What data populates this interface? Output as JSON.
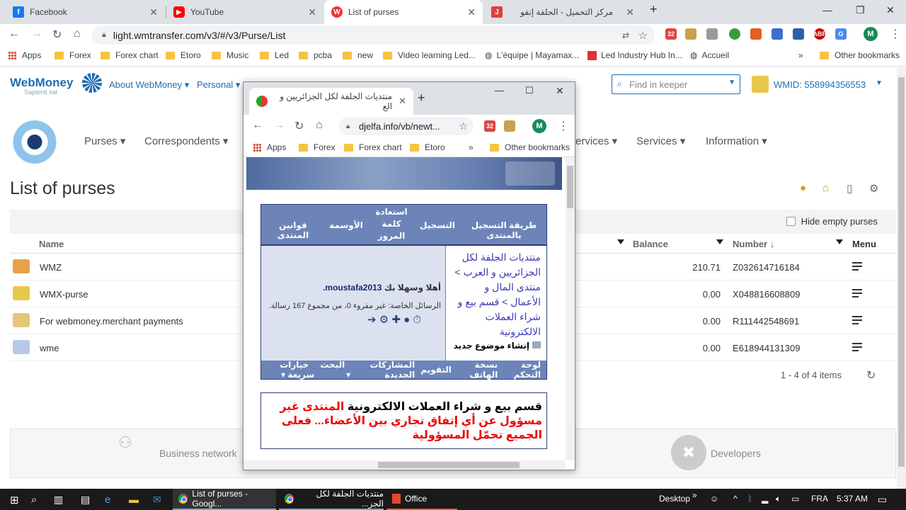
{
  "browser": {
    "tabs": [
      {
        "label": "Facebook",
        "icon": "facebook-icon"
      },
      {
        "label": "YouTube",
        "icon": "youtube-icon"
      },
      {
        "label": "List of purses",
        "icon": "webmoney-icon"
      },
      {
        "label": "مركز التحميل - الجلفة إنفو",
        "icon": "djelfa-icon"
      }
    ],
    "url": "light.wmtransfer.com/v3/#/v3/Purse/List",
    "bookmarks": [
      "Apps",
      "Forex",
      "Forex chart",
      "Etoro",
      "Music",
      "Led",
      "pcba",
      "new",
      "Video learning Led...",
      "L'équipe | Mayamax...",
      "Led Industry Hub In...",
      "Accueil",
      "Other bookmarks"
    ],
    "ext_badge": "32",
    "profile": "M"
  },
  "wm": {
    "logo": "WebMoney",
    "logo_sub": "Sapienti sat",
    "about": "About WebMoney",
    "personal": "Personal",
    "search_placeholder": "Find in keeper",
    "wmid": "WMID: 558994356553",
    "nav": [
      "Purses",
      "Correspondents",
      "ervices",
      "Services",
      "Information"
    ],
    "title": "List of purses",
    "hide_empty": "Hide empty purses",
    "columns": {
      "name": "Name",
      "balance": "Balance",
      "number": "Number ↓",
      "menu": "Menu"
    },
    "purses": [
      {
        "name": "WMZ",
        "balance": "210.71",
        "number": "Z032614716184",
        "color": "#e8a14a"
      },
      {
        "name": "WMX-purse",
        "balance": "0.00",
        "number": "X048816608809",
        "color": "#e8c84a"
      },
      {
        "name": "For webmoney.merchant payments",
        "balance": "0.00",
        "number": "R111442548691",
        "color": "#e3c67a"
      },
      {
        "name": "wme",
        "balance": "0.00",
        "number": "E618944131309",
        "color": "#b8c8e8"
      }
    ],
    "pager": "1 - 4 of 4 items",
    "footer": {
      "business": "Business network",
      "developers": "Developers"
    }
  },
  "popup": {
    "tab_title": "منتديات الجلفة لكل الجزائريين و الع",
    "url": "djelfa.info/vb/newt...",
    "bookmarks": [
      "Apps",
      "Forex",
      "Forex chart",
      "Etoro",
      "Other bookmarks"
    ],
    "ext_badge": "32",
    "profile": "M",
    "head": [
      "طريقة التسجيل بالمنتدى",
      "التسجيل",
      "استعادة كلمة المرور",
      "الأوسمة",
      "قوانين المنتدى"
    ],
    "breadcrumb": "منتديات الجلفة لكل الجزائريين و العرب > منتدى المال و الأعمال > قسم بيع و شراء العملات الالكترونية",
    "new_topic": "إنشاء موضوع جديد",
    "welcome_prefix": "أهلا وسهلا بك",
    "username": "moustafa2013",
    "pm": "الرسائل الخاصة: غير مقروء 0، من مجموع 167 رسالة.",
    "menu": [
      "لوحة التحكم",
      "نسخة الهاتف",
      "التقويم",
      "المشاركات الجديدة",
      "البحث",
      "خيارات سريعة"
    ],
    "notice_black": "قسم بيع و شراء العملات الالكترونية",
    "notice_red": "المنتدى غير مسؤول عن أي إتفاق تجاري بين الأعضاء... فعلى الجميع تحمّل المسؤولية"
  },
  "taskbar": {
    "items": [
      "List of purses - Googl...",
      "منتديات الجلفة لكل الجز...",
      "Office"
    ],
    "desktop": "Desktop",
    "lang": "FRA",
    "time": "5:37 AM"
  }
}
